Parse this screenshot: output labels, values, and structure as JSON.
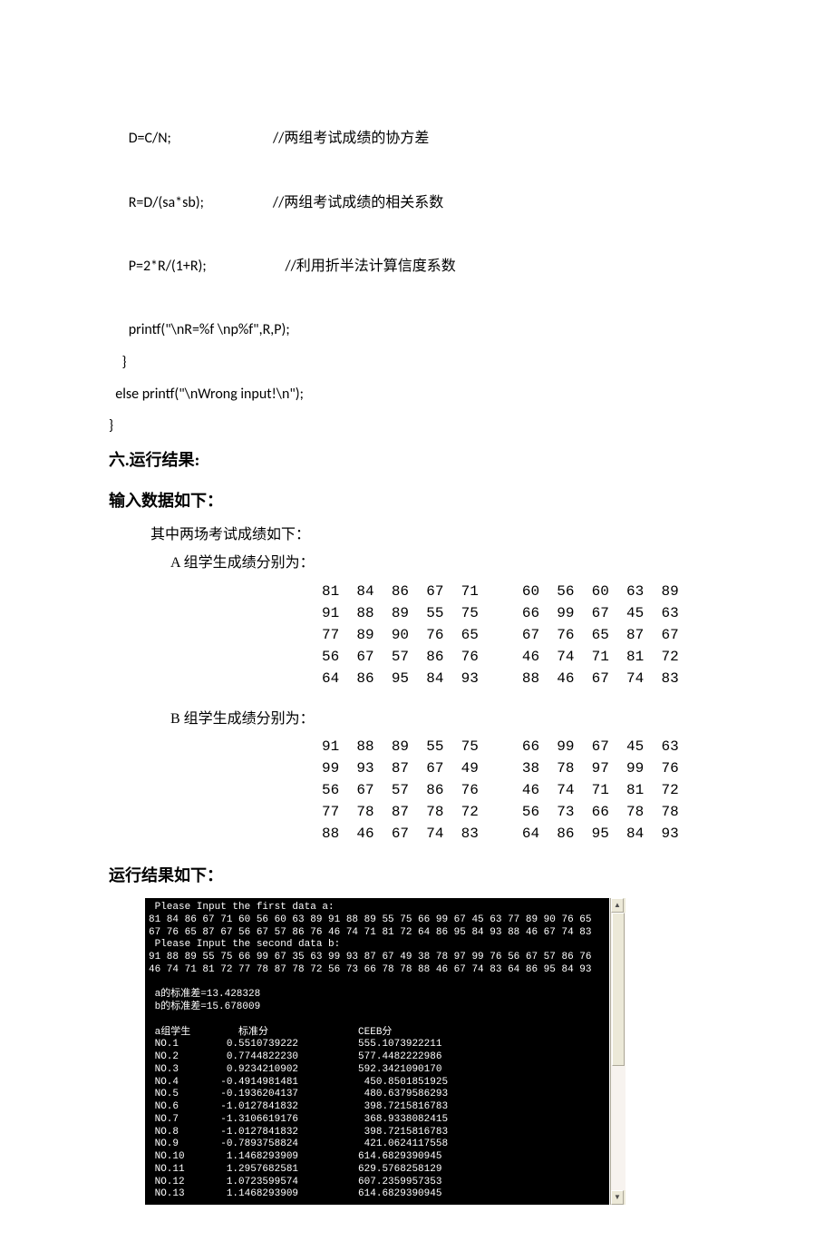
{
  "code": {
    "l1": "      D=C/N;                               //两组考试成绩的协方差",
    "l2": "      R=D/(sa*sb);                     //两组考试成绩的相关系数",
    "l3": "      P=2*R/(1+R);                        //利用折半法计算信度系数",
    "l4": "      printf(\"\\nR=%f \\np%f\",R,P);",
    "l5": "    }",
    "l6": "  else printf(\"\\nWrong input!\\n\");",
    "l7": "}"
  },
  "headings": {
    "section": "六.运行结果:",
    "input": "输入数据如下：",
    "two_exams": "其中两场考试成绩如下：",
    "groupA": "A 组学生成绩分别为：",
    "groupB": "B 组学生成绩分别为：",
    "run": "运行结果如下："
  },
  "scoresA": "81  84  86  67  71     60  56  60  63  89\n91  88  89  55  75     66  99  67  45  63\n77  89  90  76  65     67  76  65  87  67\n56  67  57  86  76     46  74  71  81  72\n64  86  95  84  93     88  46  67  74  83",
  "scoresB": "91  88  89  55  75     66  99  67  45  63\n99  93  87  67  49     38  78  97  99  76\n56  67  57  86  76     46  74  71  81  72\n77  78  87  78  72     56  73  66  78  78\n88  46  67  74  83     64  86  95  84  93",
  "terminal": " Please Input the first data a:\n81 84 86 67 71 60 56 60 63 89 91 88 89 55 75 66 99 67 45 63 77 89 90 76 65\n67 76 65 87 67 56 67 57 86 76 46 74 71 81 72 64 86 95 84 93 88 46 67 74 83\n Please Input the second data b:\n91 88 89 55 75 66 99 67 35 63 99 93 87 67 49 38 78 97 99 76 56 67 57 86 76\n46 74 71 81 72 77 78 87 78 72 56 73 66 78 78 88 46 67 74 83 64 86 95 84 93\n\n a的标准差=13.428328\n b的标准差=15.678009\n\n a组学生        标准分               CEEB分\n NO.1        0.5510739222          555.1073922211\n NO.2        0.7744822230          577.4482222986\n NO.3        0.9234210902          592.3421090170\n NO.4       -0.4914981481           450.8501851925\n NO.5       -0.1936204137           480.6379586293\n NO.6       -1.0127841832           398.7215816783\n NO.7       -1.3106619176           368.9338082415\n NO.8       -1.0127841832           398.7215816783\n NO.9       -0.7893758824           421.0624117558\n NO.10       1.1468293909          614.6829390945\n NO.11       1.2957682581          629.5768258129\n NO.12       1.0723599574          607.2359957353\n NO.13       1.1468293909          614.6829390945",
  "scroll": {
    "up": "▲",
    "down": "▼"
  },
  "chart_data": {
    "type": "table",
    "title": "标准分 / CEEB分 (a组学生)",
    "stdev_a": 13.428328,
    "stdev_b": 15.678009,
    "columns": [
      "NO",
      "标准分",
      "CEEB分"
    ],
    "rows": [
      [
        1,
        0.5510739222,
        555.1073922211
      ],
      [
        2,
        0.774482223,
        577.4482222986
      ],
      [
        3,
        0.9234210902,
        592.342109017
      ],
      [
        4,
        -0.4914981481,
        450.8501851925
      ],
      [
        5,
        -0.1936204137,
        480.6379586293
      ],
      [
        6,
        -1.0127841832,
        398.7215816783
      ],
      [
        7,
        -1.3106619176,
        368.9338082415
      ],
      [
        8,
        -1.0127841832,
        398.7215816783
      ],
      [
        9,
        -0.7893758824,
        421.0624117558
      ],
      [
        10,
        1.1468293909,
        614.6829390945
      ],
      [
        11,
        1.2957682581,
        629.5768258129
      ],
      [
        12,
        1.0723599574,
        607.2359957353
      ],
      [
        13,
        1.1468293909,
        614.6829390945
      ]
    ],
    "group_a_scores": [
      81,
      84,
      86,
      67,
      71,
      60,
      56,
      60,
      63,
      89,
      91,
      88,
      89,
      55,
      75,
      66,
      99,
      67,
      45,
      63,
      77,
      89,
      90,
      76,
      65,
      67,
      76,
      65,
      87,
      67,
      56,
      67,
      57,
      86,
      76,
      46,
      74,
      71,
      81,
      72,
      64,
      86,
      95,
      84,
      93,
      88,
      46,
      67,
      74,
      83
    ],
    "group_b_scores": [
      91,
      88,
      89,
      55,
      75,
      66,
      99,
      67,
      45,
      63,
      99,
      93,
      87,
      67,
      49,
      38,
      78,
      97,
      99,
      76,
      56,
      67,
      57,
      86,
      76,
      46,
      74,
      71,
      81,
      72,
      77,
      78,
      87,
      78,
      72,
      56,
      73,
      66,
      78,
      78,
      88,
      46,
      67,
      74,
      83,
      64,
      86,
      95,
      84,
      93
    ]
  }
}
